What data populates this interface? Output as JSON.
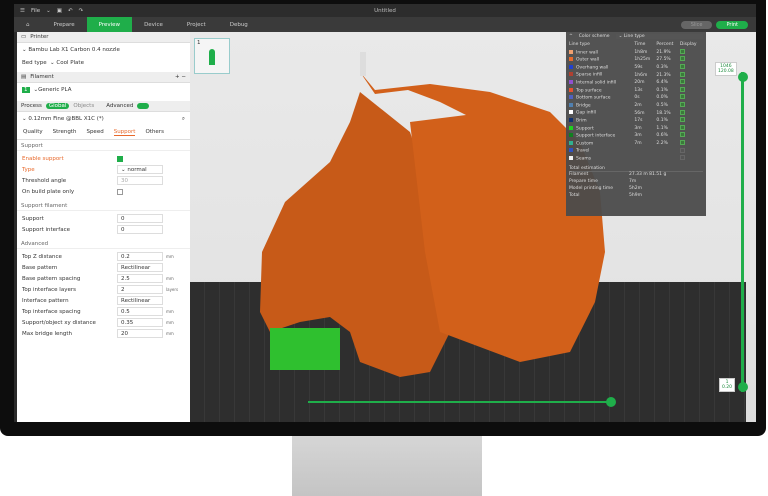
{
  "window": {
    "title": "Untitled",
    "menu": "File"
  },
  "tabs": [
    "Prepare",
    "Preview",
    "Device",
    "Project",
    "Debug"
  ],
  "active_tab": "Preview",
  "actions": {
    "slice": "Slice",
    "print": "Print"
  },
  "printer": {
    "section": "Printer",
    "name": "Bambu Lab X1 Carbon 0.4 nozzle",
    "bed_type_label": "Bed type",
    "bed_type": "Cool Plate"
  },
  "filament": {
    "section": "Filament",
    "index": "1",
    "name": "Generic PLA"
  },
  "process": {
    "section": "Process",
    "global": "Global",
    "objects": "Objects",
    "advanced": "Advanced",
    "profile": "0.12mm Fine @BBL X1C (*)",
    "subtabs": [
      "Quality",
      "Strength",
      "Speed",
      "Support",
      "Others"
    ],
    "active_subtab": "Support"
  },
  "support": {
    "group": "Support",
    "enable_label": "Enable support",
    "enable": true,
    "type_label": "Type",
    "type": "normal",
    "threshold_label": "Threshold angle",
    "threshold": "30",
    "build_plate_label": "On build plate only",
    "build_plate": false
  },
  "support_filament": {
    "group": "Support filament",
    "support_label": "Support",
    "support": "0",
    "interface_label": "Support interface",
    "interface": "0"
  },
  "advanced": {
    "group": "Advanced",
    "rows": [
      {
        "label": "Top Z distance",
        "value": "0.2",
        "unit": "mm"
      },
      {
        "label": "Base pattern",
        "value": "Rectilinear",
        "unit": ""
      },
      {
        "label": "Base pattern spacing",
        "value": "2.5",
        "unit": "mm"
      },
      {
        "label": "Top interface layers",
        "value": "2",
        "unit": "layers"
      },
      {
        "label": "Interface pattern",
        "value": "Rectilinear",
        "unit": ""
      },
      {
        "label": "Top interface spacing",
        "value": "0.5",
        "unit": "mm"
      },
      {
        "label": "Support/object xy distance",
        "value": "0.35",
        "unit": "mm"
      },
      {
        "label": "Max bridge length",
        "value": "20",
        "unit": "mm"
      }
    ]
  },
  "plate_thumb": {
    "number": "1"
  },
  "legend": {
    "scheme_label": "Color scheme",
    "scheme": "Line type",
    "headers": [
      "Line type",
      "Time",
      "Percent",
      "Display"
    ],
    "rows": [
      {
        "name": "Inner wall",
        "time": "1h8m",
        "pct": "21.9%",
        "color": "#f0a070",
        "on": true
      },
      {
        "name": "Outer wall",
        "time": "1h25m",
        "pct": "27.5%",
        "color": "#e8692b",
        "on": true
      },
      {
        "name": "Overhang wall",
        "time": "59s",
        "pct": "0.3%",
        "color": "#2040d0",
        "on": true
      },
      {
        "name": "Sparse infill",
        "time": "1h6m",
        "pct": "21.3%",
        "color": "#b04030",
        "on": true
      },
      {
        "name": "Internal solid infill",
        "time": "20m",
        "pct": "6.4%",
        "color": "#9050d0",
        "on": true
      },
      {
        "name": "Top surface",
        "time": "13s",
        "pct": "0.1%",
        "color": "#e85030",
        "on": true
      },
      {
        "name": "Bottom surface",
        "time": "0s",
        "pct": "0.0%",
        "color": "#5060c0",
        "on": true
      },
      {
        "name": "Bridge",
        "time": "2m",
        "pct": "0.5%",
        "color": "#5080b0",
        "on": true
      },
      {
        "name": "Gap infill",
        "time": "56m",
        "pct": "18.1%",
        "color": "#ffffff",
        "on": true
      },
      {
        "name": "Brim",
        "time": "17s",
        "pct": "0.1%",
        "color": "#103070",
        "on": true
      },
      {
        "name": "Support",
        "time": "3m",
        "pct": "1.1%",
        "color": "#20d020",
        "on": true
      },
      {
        "name": "Support interface",
        "time": "3m",
        "pct": "0.6%",
        "color": "#108020",
        "on": true
      },
      {
        "name": "Custom",
        "time": "7m",
        "pct": "2.2%",
        "color": "#30b090",
        "on": true
      },
      {
        "name": "Travel",
        "time": "",
        "pct": "",
        "color": "#3050c0",
        "on": false
      },
      {
        "name": "Seams",
        "time": "",
        "pct": "",
        "color": "#f0f0f0",
        "on": false
      }
    ],
    "total_label": "Total estimation",
    "summary": [
      {
        "label": "Filament",
        "value": "27.33 m    81.51 g"
      },
      {
        "label": "Prepare time",
        "value": "7m"
      },
      {
        "label": "Model printing time",
        "value": "5h2m"
      },
      {
        "label": "Total",
        "value": "5h9m"
      }
    ]
  },
  "layer_slider": {
    "top_layer": "1046",
    "top_height": "120.08",
    "bottom_layer": "1",
    "bottom_height": "0.20"
  },
  "colors": {
    "accent": "#1fae4a",
    "model": "#d2601a",
    "support": "#2fc02f"
  }
}
